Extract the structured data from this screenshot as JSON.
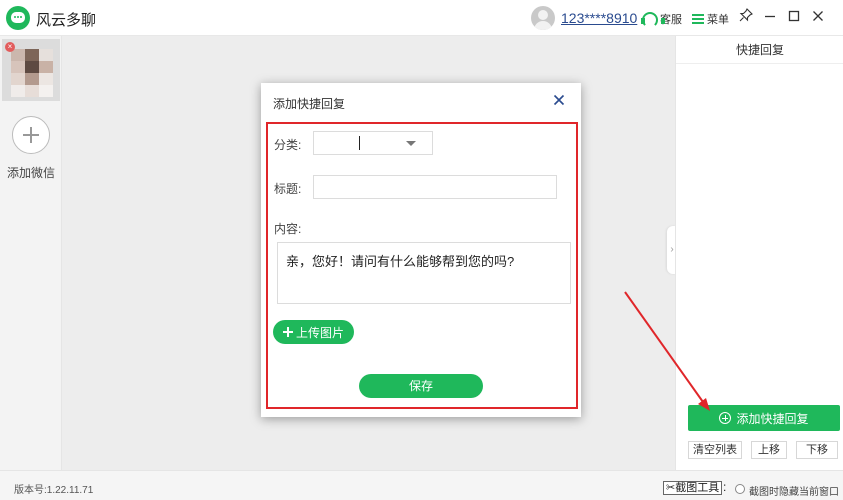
{
  "app": {
    "title": "风云多聊"
  },
  "header": {
    "user_name": "123****8910",
    "support_label": "客服",
    "menu_label": "菜单"
  },
  "sidebar": {
    "add_wechat_label": "添加微信"
  },
  "dialog": {
    "title": "添加快捷回复",
    "category_label": "分类:",
    "category_value": "",
    "title_label": "标题:",
    "title_value": "",
    "content_label": "内容:",
    "content_value": "亲，您好！请问有什么能够帮到您的吗?",
    "upload_label": "上传图片",
    "save_label": "保存"
  },
  "right_panel": {
    "header": "快捷回复",
    "add_button": "添加快捷回复",
    "clear_button": "清空列表",
    "move_up_button": "上移",
    "move_down_button": "下移"
  },
  "status_bar": {
    "version": "版本号:1.22.11.71",
    "screenshot_tool": "截图工具",
    "colon": ":",
    "hide_window_label": "截图时隐藏当前窗口"
  },
  "colors": {
    "accent": "#1fb85b",
    "highlight": "#e0262a",
    "link": "#2a4b8f"
  },
  "icons": [
    "chat-bubble-logo-icon",
    "user-avatar-icon",
    "headset-icon",
    "menu-icon",
    "pin-icon",
    "minimize-icon",
    "maximize-icon",
    "close-icon",
    "plus-icon",
    "dropdown-arrow-icon",
    "plus-circle-icon",
    "scissors-icon",
    "chevron-right-icon"
  ]
}
